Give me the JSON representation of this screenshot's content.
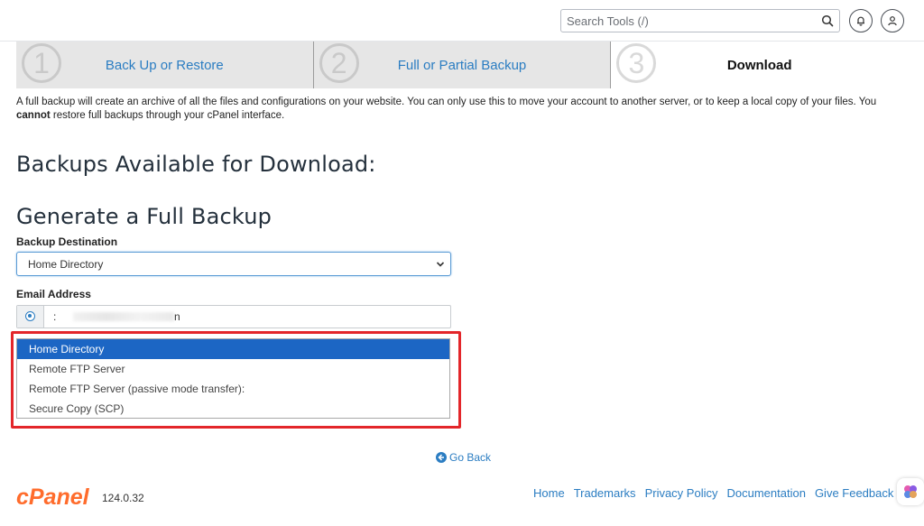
{
  "header": {
    "search_placeholder": "Search Tools (/)",
    "icons": [
      "search-icon",
      "bell-icon",
      "user-icon"
    ]
  },
  "wizard": {
    "steps": [
      {
        "number": "1",
        "label": "Back Up or Restore",
        "active": false
      },
      {
        "number": "2",
        "label": "Full or Partial Backup",
        "active": false
      },
      {
        "number": "3",
        "label": "Download",
        "active": true
      }
    ]
  },
  "intro": {
    "text_1": "A full backup will create an archive of all the files and configurations on your website. You can only use this to move your account to another server, or to keep a local copy of your files. You ",
    "bold": "cannot",
    "text_2": " restore full backups through your cPanel interface."
  },
  "sections": {
    "available_title": "Backups Available for Download:",
    "generate_title": "Generate a Full Backup"
  },
  "form": {
    "destination_label": "Backup Destination",
    "destination_value": "Home Directory",
    "email_label": "Email Address",
    "email_value_start": ":",
    "email_value_end": "n",
    "destination_options": [
      "Home Directory",
      "Remote FTP Server",
      "Remote FTP Server (passive mode transfer):",
      "Secure Copy (SCP)"
    ],
    "selected_option_index": 0
  },
  "go_back_label": "Go Back",
  "footer": {
    "logo_text": "cPanel",
    "version": "124.0.32",
    "links": [
      "Home",
      "Trademarks",
      "Privacy Policy",
      "Documentation",
      "Give Feedback"
    ]
  },
  "colors": {
    "link": "#2b7dc2",
    "selected_option": "#1c66c4",
    "highlight_frame": "#e3262a",
    "logo": "#ff6c2c"
  }
}
